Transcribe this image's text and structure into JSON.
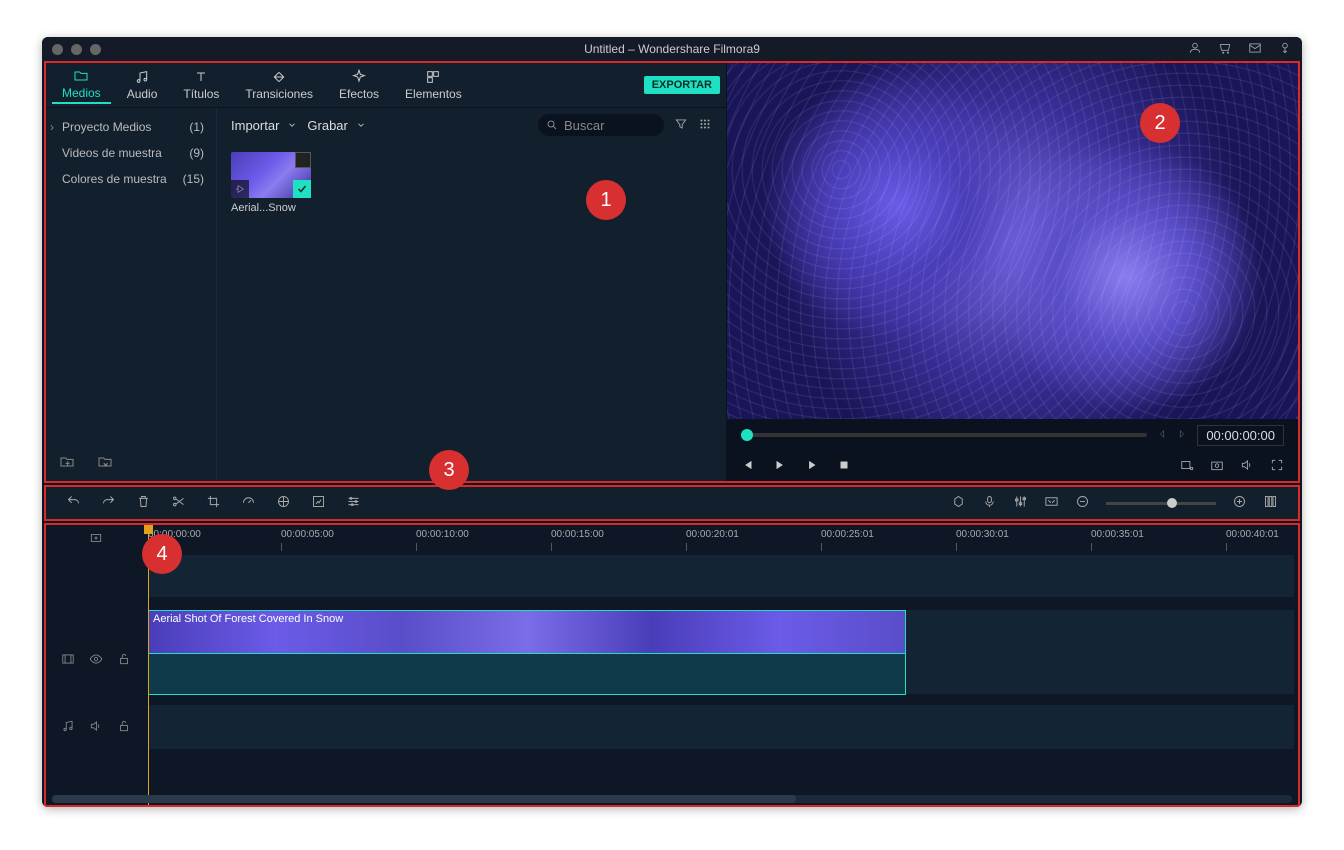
{
  "window": {
    "title": "Untitled – Wondershare Filmora9"
  },
  "tabs": [
    {
      "label": "Medios",
      "active": true
    },
    {
      "label": "Audio"
    },
    {
      "label": "Títulos"
    },
    {
      "label": "Transiciones"
    },
    {
      "label": "Efectos"
    },
    {
      "label": "Elementos"
    }
  ],
  "export_label": "EXPORTAR",
  "sidebar": [
    {
      "label": "Proyecto Medios",
      "count": "(1)"
    },
    {
      "label": "Videos de muestra",
      "count": "(9)"
    },
    {
      "label": "Colores de muestra",
      "count": "(15)"
    }
  ],
  "content_bar": {
    "import": "Importar",
    "record": "Grabar",
    "search_placeholder": "Buscar"
  },
  "thumb": {
    "label": "Aerial...Snow"
  },
  "preview": {
    "timecode": "00:00:00:00"
  },
  "ruler": [
    "00:00:00:00",
    "00:00:05:00",
    "00:00:10:00",
    "00:00:15:00",
    "00:00:20:01",
    "00:00:25:01",
    "00:00:30:01",
    "00:00:35:01",
    "00:00:40:01"
  ],
  "clip": {
    "label": "Aerial Shot Of Forest Covered In Snow"
  },
  "annotations": [
    "1",
    "2",
    "3",
    "4"
  ]
}
